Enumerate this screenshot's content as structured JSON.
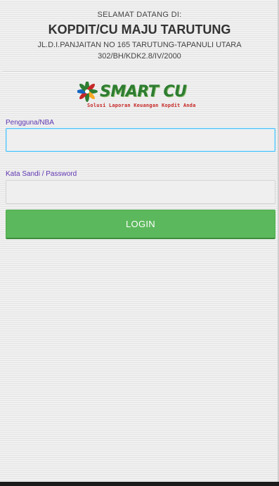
{
  "header": {
    "welcome": "SELAMAT DATANG DI:",
    "org_name": "KOPDIT/CU MAJU TARUTUNG",
    "address": "JL.D.I.PANJAITAN NO 165 TARUTUNG-TAPANULI UTARA",
    "registration": "302/BH/KDK2.8/IV/2000"
  },
  "logo": {
    "brand": "SMART CU",
    "tagline": "Solusi Laporan Keuangan Kopdit Anda",
    "icon": "flower-logo-icon",
    "colors": {
      "brand": "#2e7d32",
      "tagline": "#c62828",
      "petals": [
        "#2e7d32",
        "#c62828",
        "#f9a825",
        "#1565c0"
      ]
    }
  },
  "form": {
    "username_label": "Pengguna/NBA",
    "username_value": "",
    "password_label": "Kata Sandi / Password",
    "password_value": "",
    "login_label": "LOGIN"
  },
  "colors": {
    "label": "#5e35b1",
    "button": "#5cb85c",
    "focus_border": "#4fc3f7"
  }
}
